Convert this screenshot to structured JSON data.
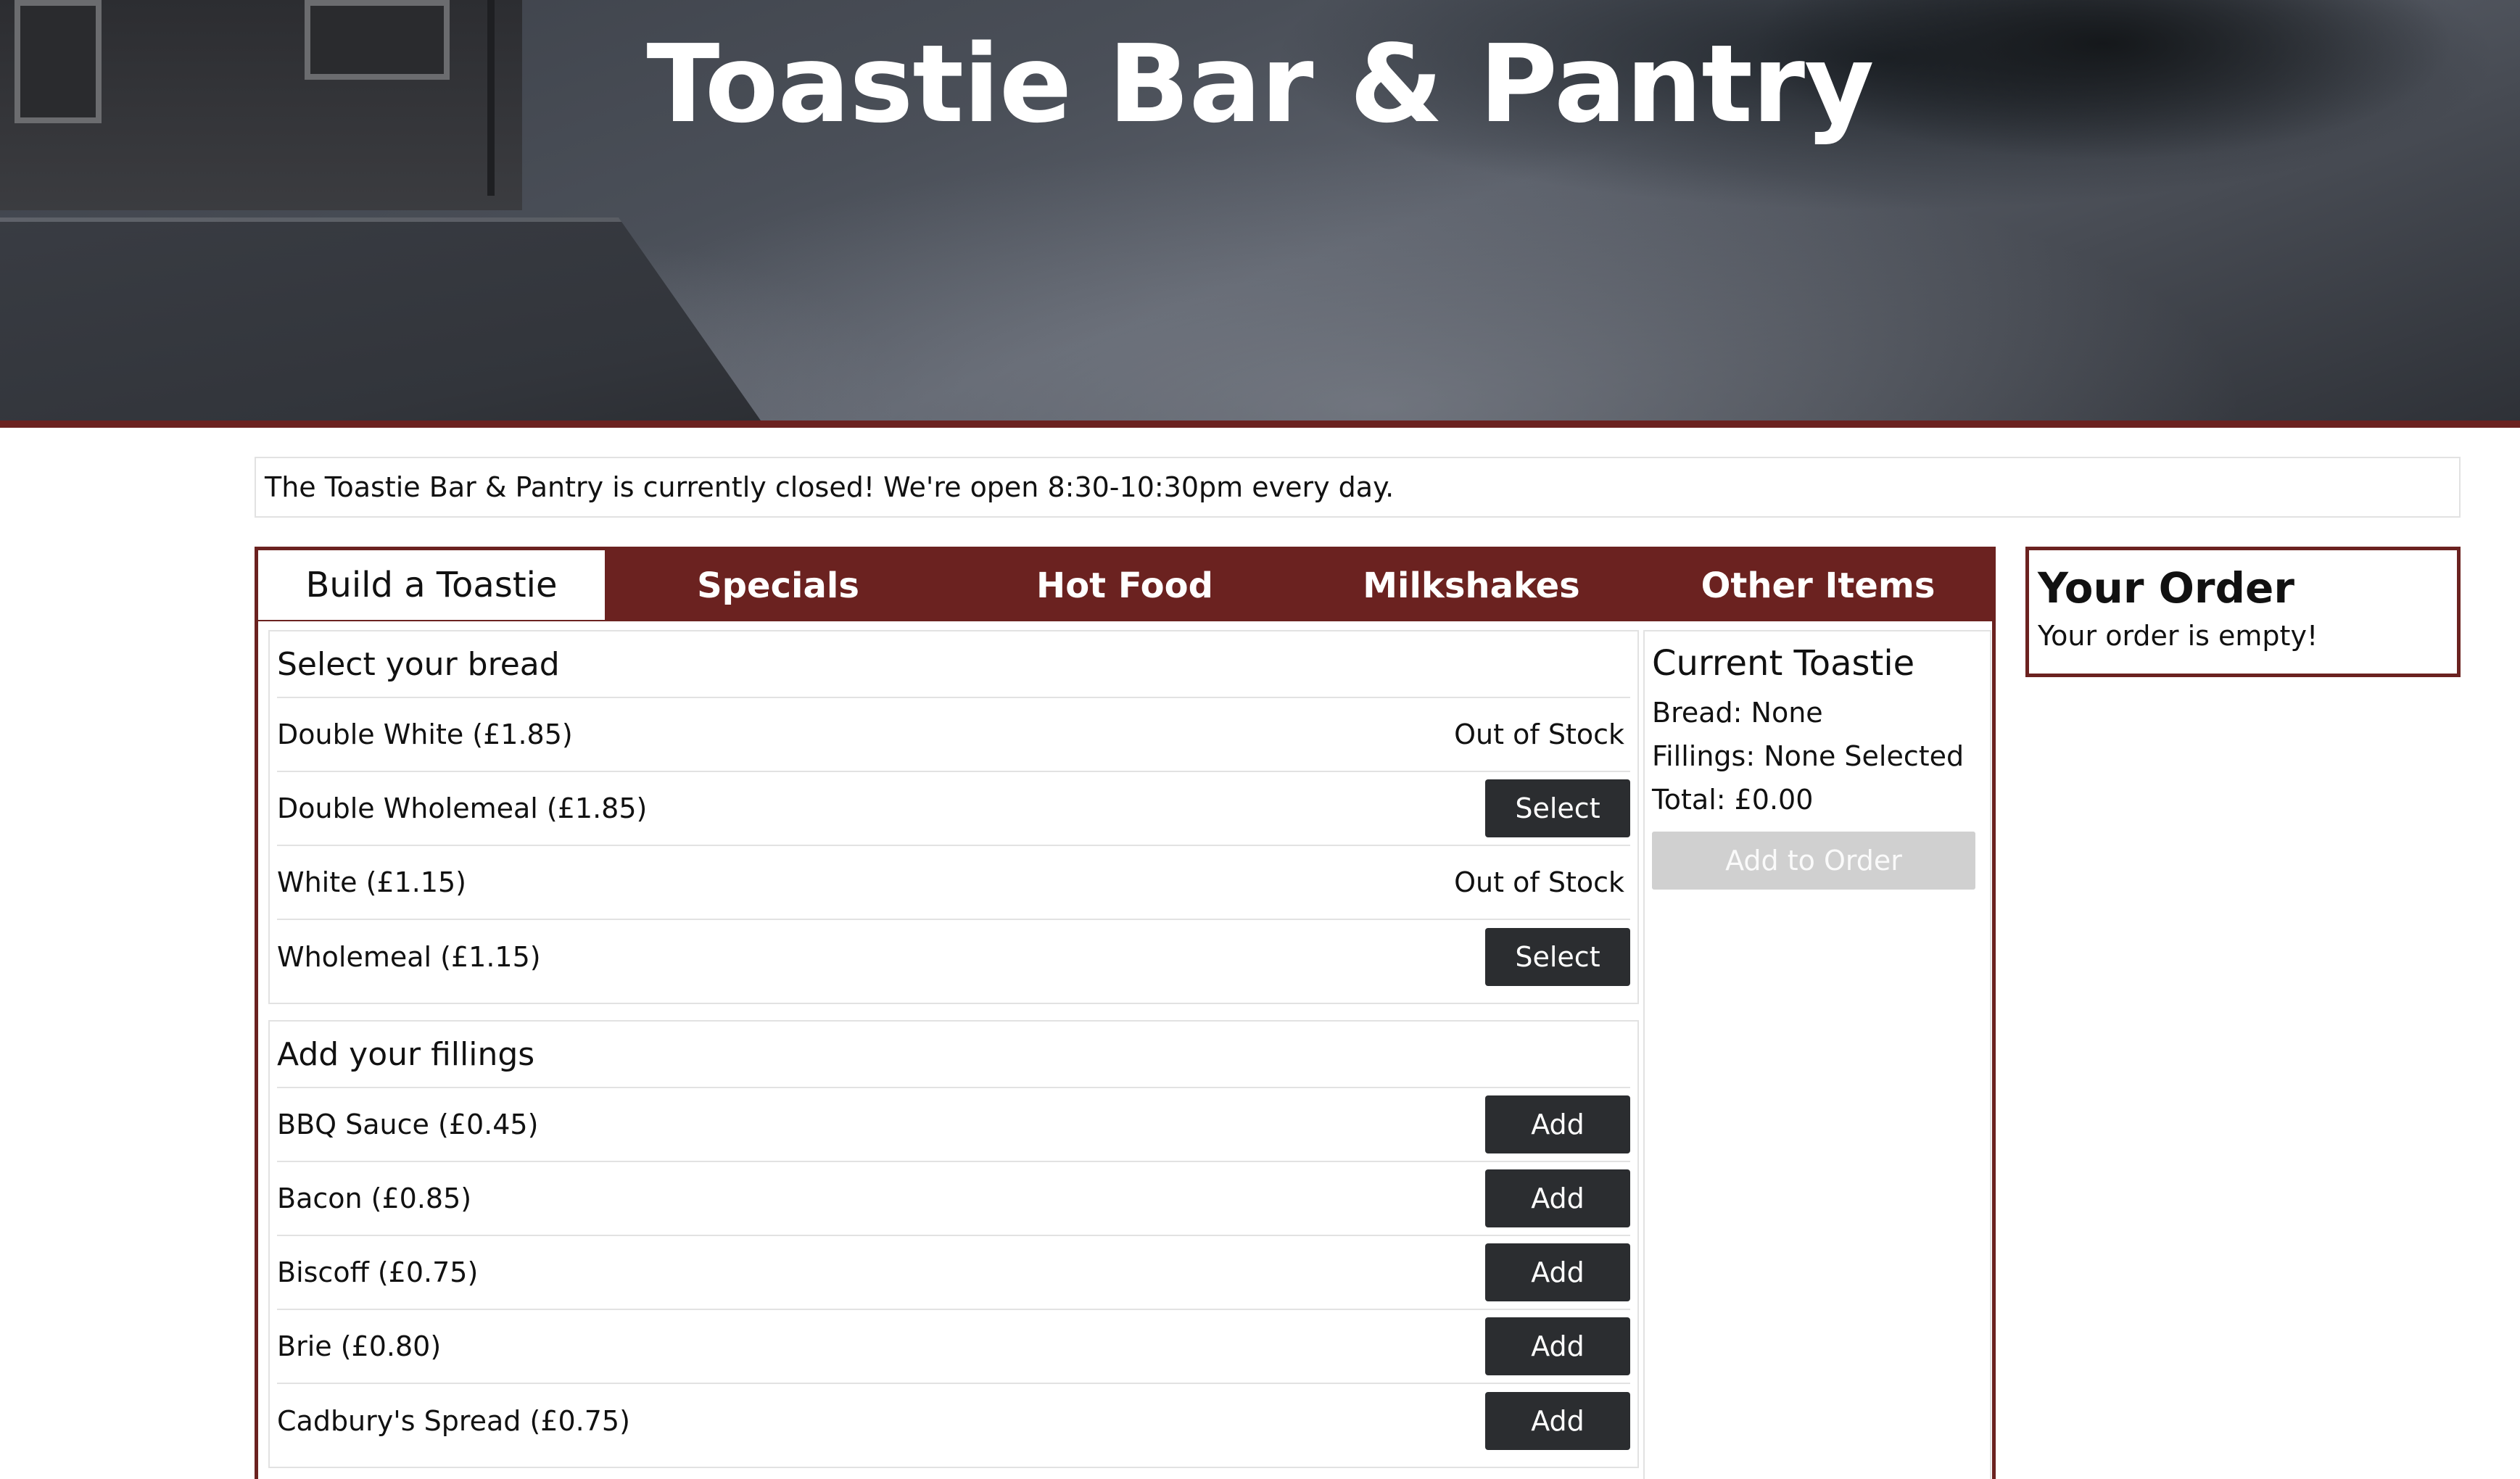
{
  "header": {
    "title": "Toastie Bar & Pantry"
  },
  "notice": "The Toastie Bar & Pantry is currently closed! We're open 8:30-10:30pm every day.",
  "tabs": [
    "Build a Toastie",
    "Specials",
    "Hot Food",
    "Milkshakes",
    "Other Items"
  ],
  "active_tab": "Build a Toastie",
  "bread": {
    "title": "Select your bread",
    "items": [
      {
        "label": "Double White (£1.85)",
        "status": "Out of Stock"
      },
      {
        "label": "Double Wholemeal (£1.85)",
        "button": "Select"
      },
      {
        "label": "White (£1.15)",
        "status": "Out of Stock"
      },
      {
        "label": "Wholemeal (£1.15)",
        "button": "Select"
      }
    ]
  },
  "fillings": {
    "title": "Add your fillings",
    "items": [
      {
        "label": "BBQ Sauce (£0.45)",
        "button": "Add"
      },
      {
        "label": "Bacon (£0.85)",
        "button": "Add"
      },
      {
        "label": "Biscoff (£0.75)",
        "button": "Add"
      },
      {
        "label": "Brie (£0.80)",
        "button": "Add"
      },
      {
        "label": "Cadbury's Spread (£0.75)",
        "button": "Add"
      }
    ]
  },
  "current_toastie": {
    "title": "Current Toastie",
    "bread": "Bread: None",
    "fillings": "Fillings: None Selected",
    "total": "Total: £0.00",
    "add_button": "Add to Order"
  },
  "order": {
    "title": "Your Order",
    "empty_text": "Your order is empty!"
  },
  "colors": {
    "brand": "#6b2220",
    "button": "#2b2d30",
    "disabled_button": "#d0d0d0"
  }
}
